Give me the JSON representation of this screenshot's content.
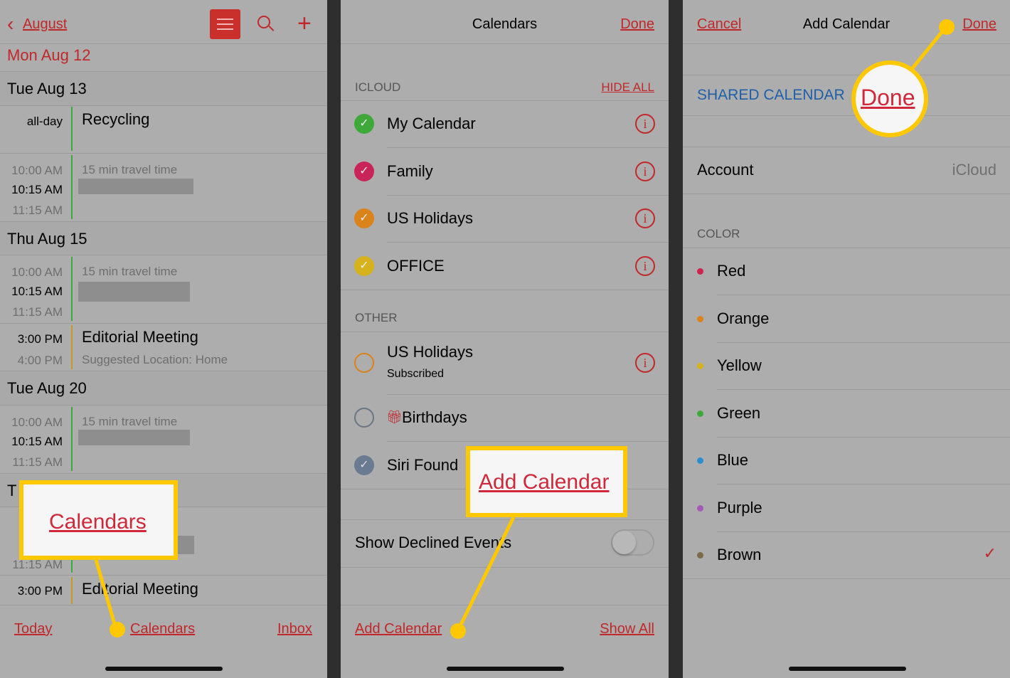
{
  "panel1": {
    "back_label": "August",
    "today_heading": "Mon  Aug 12",
    "days": [
      {
        "heading": "Tue  Aug 13"
      },
      {
        "heading": "Thu  Aug 15"
      },
      {
        "heading": "Tue  Aug 20"
      },
      {
        "heading": "T"
      }
    ],
    "allday_label": "all-day",
    "recycling": "Recycling",
    "travel": "15 min travel time",
    "t1000": "10:00 AM",
    "t1015": "10:15 AM",
    "t1115": "11:15 AM",
    "t300": "3:00 PM",
    "t400": "4:00 PM",
    "meeting": "Editorial Meeting",
    "meeting_location": "Suggested Location: Home",
    "toolbar": {
      "today": "Today",
      "calendars": "Calendars",
      "inbox": "Inbox"
    },
    "callout": "Calendars"
  },
  "panel2": {
    "title": "Calendars",
    "done": "Done",
    "icloud_header": "ICLOUD",
    "hide_all": "HIDE ALL",
    "icloud": [
      {
        "name": "My Calendar",
        "color": "#3ea83a",
        "checked": true
      },
      {
        "name": "Family",
        "color": "#c8245a",
        "checked": true
      },
      {
        "name": "US Holidays",
        "color": "#d9831a",
        "checked": true
      },
      {
        "name": "OFFICE",
        "color": "#d6b21c",
        "checked": true
      }
    ],
    "other_header": "OTHER",
    "other": [
      {
        "name": "US Holidays",
        "sub": "Subscribed",
        "color": "#d9831a",
        "checked": false
      },
      {
        "name": "Birthdays",
        "color": "#7a8a9a",
        "checked": false
      },
      {
        "name": "Siri Found",
        "color": "#6a7a90",
        "checked": true
      }
    ],
    "show_declined": "Show Declined Events",
    "show_declined_on": false,
    "toolbar": {
      "add": "Add Calendar",
      "show_all": "Show All"
    },
    "callout": "Add Calendar"
  },
  "panel3": {
    "cancel": "Cancel",
    "title": "Add Calendar",
    "done": "Done",
    "name_value": "SHARED CALENDAR",
    "account_label": "Account",
    "account_value": "iCloud",
    "color_header": "COLOR",
    "colors": [
      {
        "name": "Red",
        "hex": "#d0234d"
      },
      {
        "name": "Orange",
        "hex": "#d9831a"
      },
      {
        "name": "Yellow",
        "hex": "#d6b21c"
      },
      {
        "name": "Green",
        "hex": "#3ea83a"
      },
      {
        "name": "Blue",
        "hex": "#2a8fd0"
      },
      {
        "name": "Purple",
        "hex": "#a35ab8"
      },
      {
        "name": "Brown",
        "hex": "#7d6a4a",
        "selected": true
      }
    ],
    "callout": "Done"
  },
  "accent": "#c0282a",
  "highlight": "#ffc800"
}
